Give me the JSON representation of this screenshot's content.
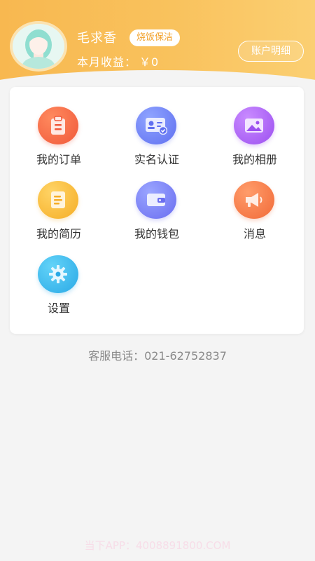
{
  "profile": {
    "name": "毛求香",
    "tag": "烧饭保洁",
    "income_label": "本月收益：",
    "income_value": "￥0",
    "account_button": "账户明细"
  },
  "menu": [
    {
      "label": "我的订单",
      "icon": "order-clipboard-icon",
      "color": "#f0583a"
    },
    {
      "label": "实名认证",
      "icon": "id-card-icon",
      "color": "#5f6ff0"
    },
    {
      "label": "我的相册",
      "icon": "photo-album-icon",
      "color": "#9c4ff0"
    },
    {
      "label": "我的简历",
      "icon": "resume-document-icon",
      "color": "#f5ad25"
    },
    {
      "label": "我的钱包",
      "icon": "wallet-icon",
      "color": "#6a6df0"
    },
    {
      "label": "消息",
      "icon": "megaphone-icon",
      "color": "#f16a38"
    },
    {
      "label": "设置",
      "icon": "gear-icon",
      "color": "#2aa9e6"
    }
  ],
  "service": {
    "label": "客服电话：",
    "phone": "021-62752837"
  },
  "watermark": "当下APP：4008891800.COM",
  "colors": {
    "header_start": "#f8b850",
    "header_end": "#fbcf72",
    "tag_text": "#f2a22c"
  }
}
